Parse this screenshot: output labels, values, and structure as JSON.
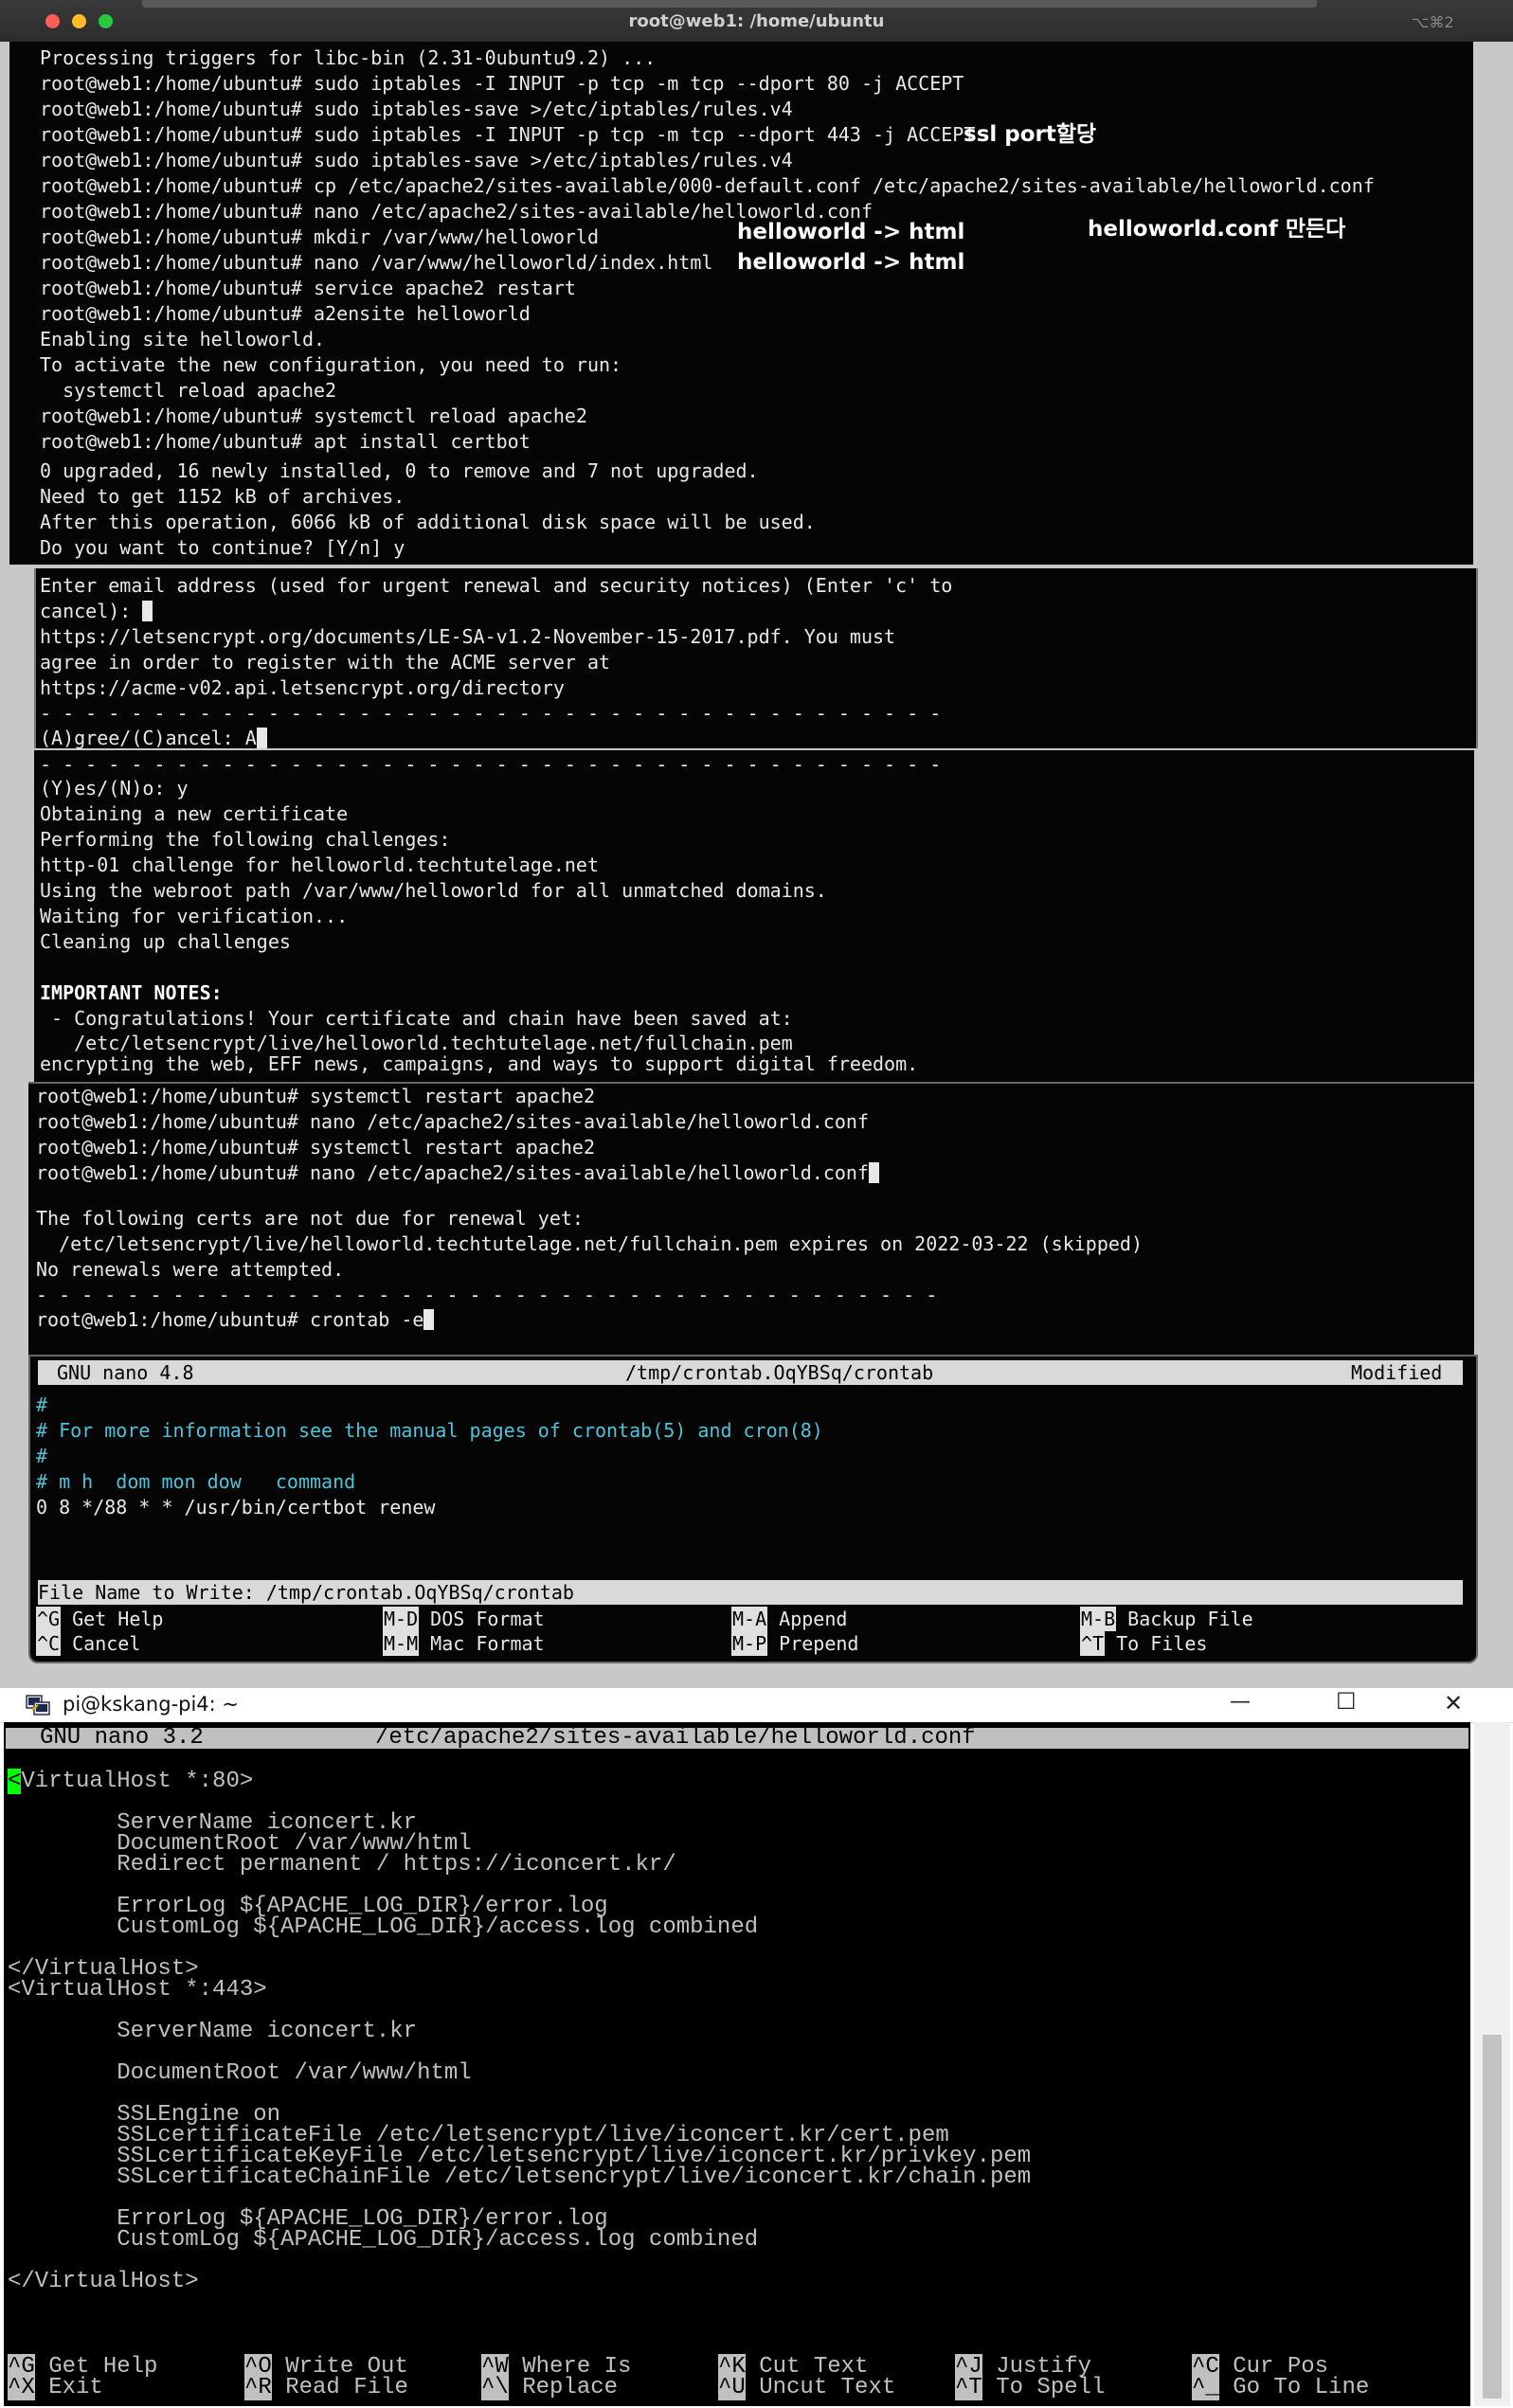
{
  "mac_window": {
    "title": "root@web1: /home/ubuntu",
    "shortcut": "⌥⌘2",
    "lines_a": [
      "Processing triggers for libc-bin (2.31-0ubuntu9.2) ...",
      "root@web1:/home/ubuntu# sudo iptables -I INPUT -p tcp -m tcp --dport 80 -j ACCEPT",
      "root@web1:/home/ubuntu# sudo iptables-save >/etc/iptables/rules.v4",
      "root@web1:/home/ubuntu# sudo iptables -I INPUT -p tcp -m tcp --dport 443 -j ACCEPT",
      "root@web1:/home/ubuntu# sudo iptables-save >/etc/iptables/rules.v4",
      "root@web1:/home/ubuntu# cp /etc/apache2/sites-available/000-default.conf /etc/apache2/sites-available/helloworld.conf",
      "root@web1:/home/ubuntu# nano /etc/apache2/sites-available/helloworld.conf",
      "root@web1:/home/ubuntu# mkdir /var/www/helloworld",
      "root@web1:/home/ubuntu# nano /var/www/helloworld/index.html",
      "root@web1:/home/ubuntu# service apache2 restart",
      "root@web1:/home/ubuntu# a2ensite helloworld",
      "Enabling site helloworld.",
      "To activate the new configuration, you need to run:",
      "  systemctl reload apache2",
      "root@web1:/home/ubuntu# systemctl reload apache2",
      "root@web1:/home/ubuntu# apt install certbot"
    ],
    "lines_b": [
      "0 upgraded, 16 newly installed, 0 to remove and 7 not upgraded.",
      "Need to get 1152 kB of archives.",
      "After this operation, 6066 kB of additional disk space will be used.",
      "Do you want to continue? [Y/n] y"
    ],
    "lines_c": [
      "Enter email address (used for urgent renewal and security notices) (Enter 'c' to",
      "cancel):"
    ],
    "lines_d": [
      "https://letsencrypt.org/documents/LE-SA-v1.2-November-15-2017.pdf. You must",
      "agree in order to register with the ACME server at",
      "https://acme-v02.api.letsencrypt.org/directory",
      "- - - - - - - - - - - - - - - - - - - - - - - - - - - - - - - - - - - - - - - -",
      "(A)gree/(C)ancel: A"
    ],
    "lines_e": [
      "- - - - - - - - - - - - - - - - - - - - - - - - - - - - - - - - - - - - - - - -",
      "(Y)es/(N)o: y",
      "Obtaining a new certificate",
      "Performing the following challenges:",
      "http-01 challenge for helloworld.techtutelage.net",
      "Using the webroot path /var/www/helloworld for all unmatched domains.",
      "Waiting for verification...",
      "Cleaning up challenges",
      "",
      "IMPORTANT NOTES:",
      " - Congratulations! Your certificate and chain have been saved at:",
      "   /etc/letsencrypt/live/helloworld.techtutelage.net/fullchain.pem",
      "encrypting the web, EFF news, campaigns, and ways to support digital freedom."
    ],
    "lines_f": [
      "root@web1:/home/ubuntu# systemctl restart apache2",
      "root@web1:/home/ubuntu# nano /etc/apache2/sites-available/helloworld.conf",
      "root@web1:/home/ubuntu# systemctl restart apache2",
      "root@web1:/home/ubuntu# nano /etc/apache2/sites-available/helloworld.conf"
    ],
    "lines_g": [
      "The following certs are not due for renewal yet:",
      "  /etc/letsencrypt/live/helloworld.techtutelage.net/fullchain.pem expires on 2022-03-22 (skipped)",
      "No renewals were attempted.",
      "- - - - - - - - - - - - - - - - - - - - - - - - - - - - - - - - - - - - - - - -",
      "",
      "root@web1:/home/ubuntu# crontab -e"
    ],
    "annotations": {
      "ssl": "ssl port할당",
      "hw1": "helloworld -> html",
      "hw2": "helloworld -> html",
      "conf": "helloworld.conf 만든다"
    },
    "nano": {
      "version": "GNU nano 4.8",
      "file": "/tmp/crontab.OqYBSq/crontab",
      "state": "Modified",
      "lines": [
        "#",
        "# For more information see the manual pages of crontab(5) and cron(8)",
        "#",
        "# m h  dom mon dow   command",
        "0 8 */88 * * /usr/bin/certbot renew"
      ],
      "prompt": "File Name to Write: /tmp/crontab.OqYBSq/crontab",
      "shortcuts_row1": [
        {
          "key": "^G",
          "label": "Get Help"
        },
        {
          "key": "M-D",
          "label": "DOS Format"
        },
        {
          "key": "M-A",
          "label": "Append"
        },
        {
          "key": "M-B",
          "label": "Backup File"
        }
      ],
      "shortcuts_row2": [
        {
          "key": "^C",
          "label": "Cancel"
        },
        {
          "key": "M-M",
          "label": "Mac Format"
        },
        {
          "key": "M-P",
          "label": "Prepend"
        },
        {
          "key": "^T",
          "label": "To Files"
        }
      ]
    }
  },
  "putty_window": {
    "title": "pi@kskang-pi4: ~",
    "nano_version": "GNU nano 3.2",
    "nano_file": "/etc/apache2/sites-available/helloworld.conf",
    "first_char": "<",
    "first_rest": "VirtualHost *:80>",
    "lines": [
      "",
      "        ServerName iconcert.kr",
      "        DocumentRoot /var/www/html",
      "        Redirect permanent / https://iconcert.kr/",
      "",
      "        ErrorLog ${APACHE_LOG_DIR}/error.log",
      "        CustomLog ${APACHE_LOG_DIR}/access.log combined",
      "",
      "</VirtualHost>",
      "<VirtualHost *:443>",
      "",
      "        ServerName iconcert.kr",
      "",
      "        DocumentRoot /var/www/html",
      "",
      "        SSLEngine on",
      "        SSLcertificateFile /etc/letsencrypt/live/iconcert.kr/cert.pem",
      "        SSLcertificateKeyFile /etc/letsencrypt/live/iconcert.kr/privkey.pem",
      "        SSLcertificateChainFile /etc/letsencrypt/live/iconcert.kr/chain.pem",
      "",
      "        ErrorLog ${APACHE_LOG_DIR}/error.log",
      "        CustomLog ${APACHE_LOG_DIR}/access.log combined",
      "",
      "</VirtualHost>"
    ],
    "shortcuts_row1": [
      {
        "key": "^G",
        "label": "Get Help"
      },
      {
        "key": "^O",
        "label": "Write Out"
      },
      {
        "key": "^W",
        "label": "Where Is"
      },
      {
        "key": "^K",
        "label": "Cut Text"
      },
      {
        "key": "^J",
        "label": "Justify"
      },
      {
        "key": "^C",
        "label": "Cur Pos"
      }
    ],
    "shortcuts_row2": [
      {
        "key": "^X",
        "label": "Exit"
      },
      {
        "key": "^R",
        "label": "Read File"
      },
      {
        "key": "^\\",
        "label": "Replace"
      },
      {
        "key": "^U",
        "label": "Uncut Text"
      },
      {
        "key": "^T",
        "label": "To Spell"
      },
      {
        "key": "^_",
        "label": "Go To Line"
      }
    ],
    "controls": {
      "minimize": "—",
      "maximize": "☐",
      "close": "✕"
    }
  },
  "colors": {
    "mac_bg": "#050505",
    "nano_comment": "#4fc3d9",
    "nano_bar": "#d9d9d9",
    "putty_cursor": "#00ff00"
  }
}
